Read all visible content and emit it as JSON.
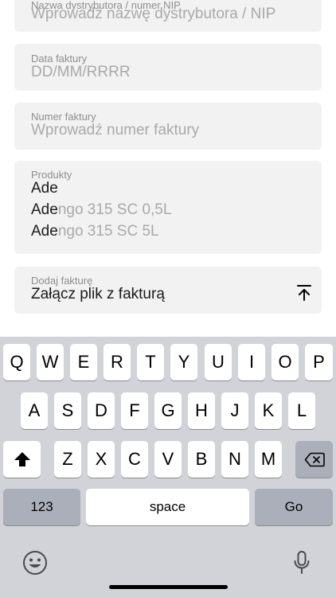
{
  "form": {
    "distributor": {
      "label": "Nazwa dystrybutora / numer NIP",
      "placeholder": "Wprowadź nazwę dystrybutora / NIP"
    },
    "invoice_date": {
      "label": "Data faktury",
      "placeholder": "DD/MM/RRRR"
    },
    "invoice_number": {
      "label": "Numer faktury",
      "placeholder": "Wprowadź numer faktury"
    },
    "products": {
      "label": "Produkty",
      "query": "Ade",
      "suggestions": [
        {
          "match": "Ade",
          "rest": "ngo 315 SC 0,5L"
        },
        {
          "match": "Ade",
          "rest": "ngo 315 SC 5L"
        }
      ]
    },
    "attachment": {
      "label": "Dodaj fakturę",
      "value": "Załącz plik z fakturą",
      "icon": "upload-icon"
    }
  },
  "keyboard": {
    "row1": [
      "Q",
      "W",
      "E",
      "R",
      "T",
      "Y",
      "U",
      "I",
      "O",
      "P"
    ],
    "row2": [
      "A",
      "S",
      "D",
      "F",
      "G",
      "H",
      "J",
      "K",
      "L"
    ],
    "row3": [
      "Z",
      "X",
      "C",
      "V",
      "B",
      "N",
      "M"
    ],
    "shift_icon": "shift-icon",
    "backspace_icon": "backspace-icon",
    "numbers_label": "123",
    "space_label": "space",
    "go_label": "Go",
    "emoji_icon": "emoji-icon",
    "mic_icon": "microphone-icon"
  }
}
